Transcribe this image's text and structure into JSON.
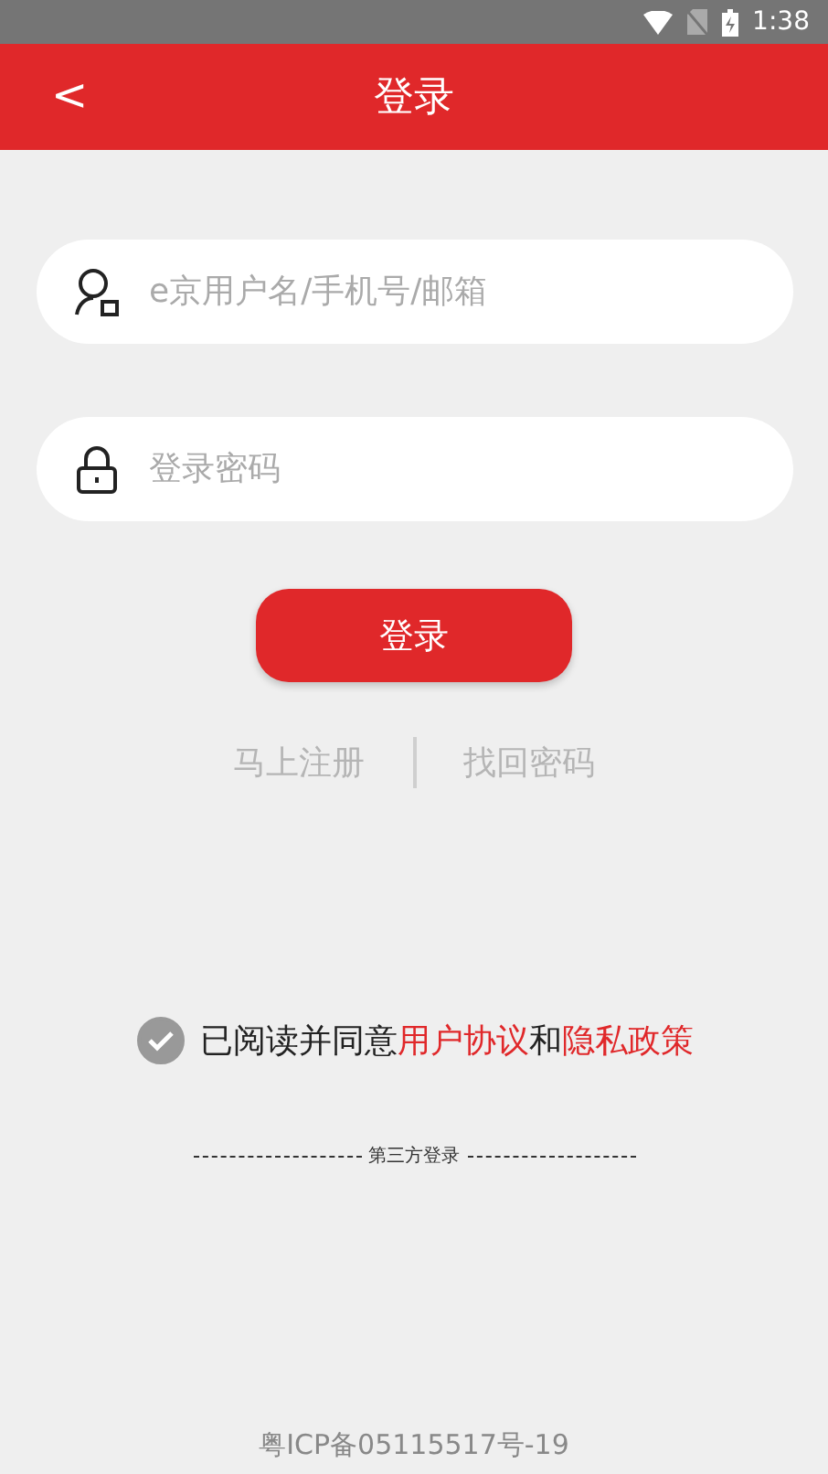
{
  "status_bar": {
    "time": "1:38"
  },
  "header": {
    "back": "<",
    "title": "登录"
  },
  "fields": [
    {
      "kind": "user",
      "placeholder": "e京用户名/手机号/邮箱"
    },
    {
      "kind": "password",
      "placeholder": "登录密码"
    }
  ],
  "login_button": "登录",
  "links": [
    "马上注册",
    "找回密码"
  ],
  "agreement": {
    "checked": true,
    "parts": [
      {
        "text": "已阅读并同意",
        "link": false
      },
      {
        "text": "用户协议",
        "link": true
      },
      {
        "text": "和",
        "link": false
      },
      {
        "text": "隐私政策",
        "link": true
      }
    ]
  },
  "third_party": "第三方登录",
  "footer": "粤ICP备05115517号-19"
}
